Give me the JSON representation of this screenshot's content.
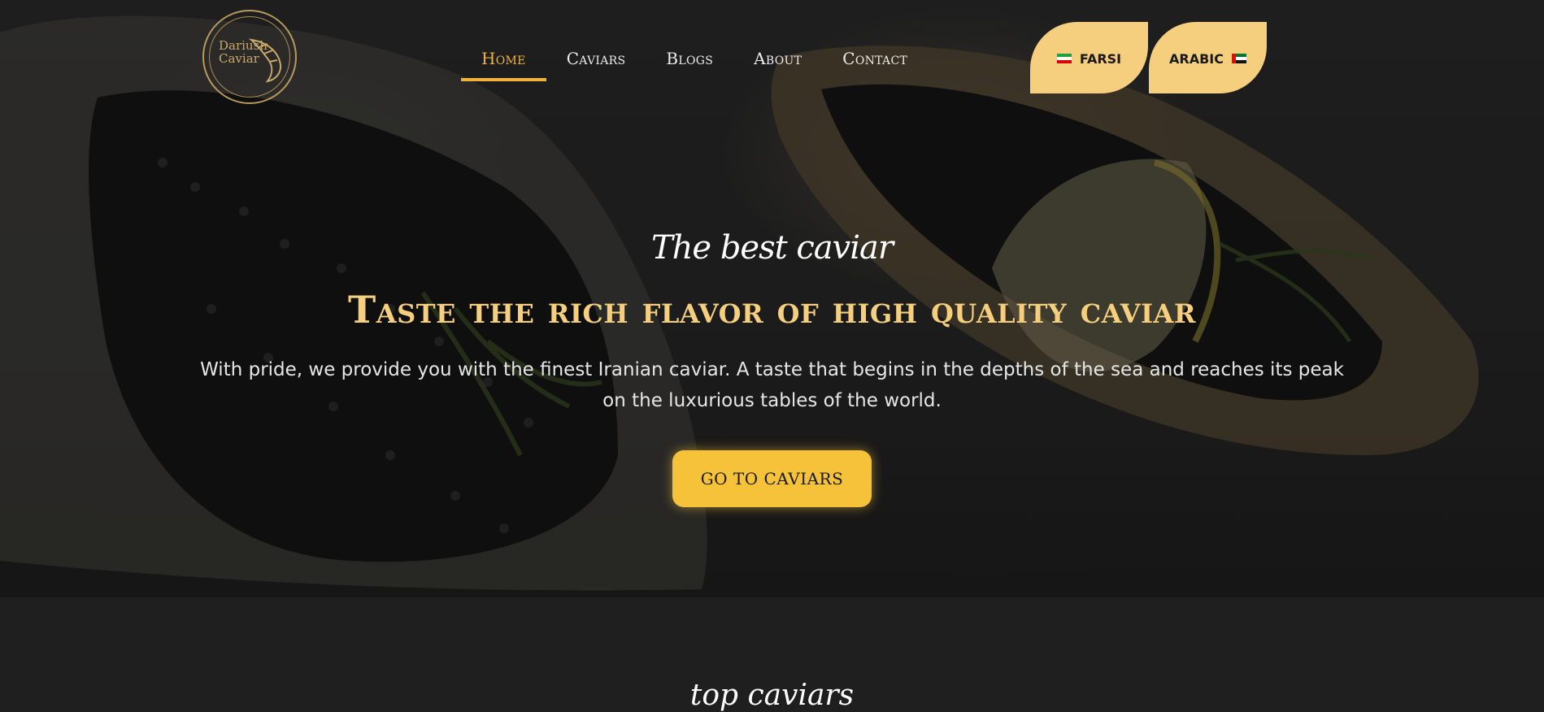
{
  "header": {
    "logo_line1": "Dariush",
    "logo_line2": "Caviar",
    "nav": [
      {
        "label": "Home",
        "active": true
      },
      {
        "label": "Caviars",
        "active": false
      },
      {
        "label": "Blogs",
        "active": false
      },
      {
        "label": "About",
        "active": false
      },
      {
        "label": "Contact",
        "active": false
      }
    ],
    "languages": [
      {
        "label": "FARSI",
        "flag": "iran-flag-icon"
      },
      {
        "label": "ARABIC",
        "flag": "uae-flag-icon"
      }
    ]
  },
  "hero": {
    "tagline": "The best caviar",
    "headline": "Taste the rich flavor of high quality caviar",
    "description": "With pride, we provide you with the finest Iranian caviar. A taste that begins in the depths of the sea and reaches its peak on the luxurious tables of the world.",
    "cta_label": "GO TO CAVIARS"
  },
  "next_section": {
    "title": "top caviars"
  },
  "colors": {
    "accent_gold": "#f5cf7e",
    "active_nav": "#f0b23a",
    "button": "#f5c23a",
    "background": "#1f1f1f"
  }
}
